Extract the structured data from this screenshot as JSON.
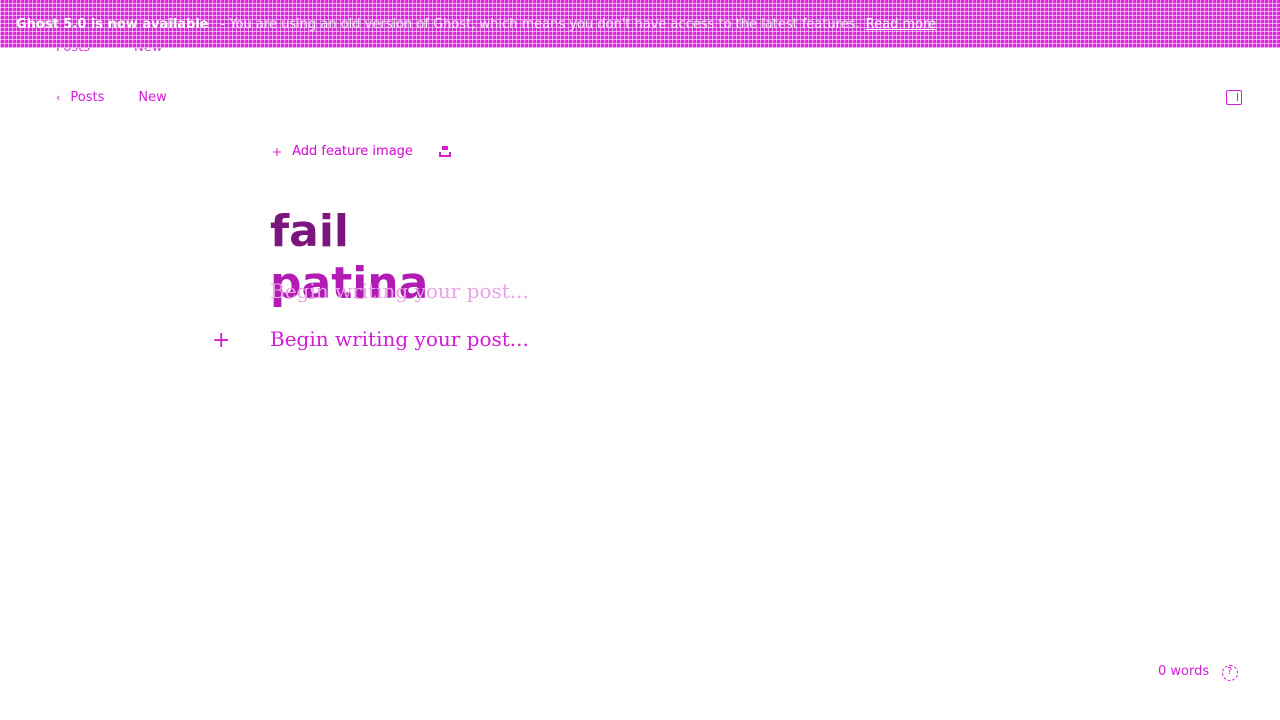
{
  "banner": {
    "strong": "Ghost 5.0 is now available",
    "message": "- You are using an old version of Ghost, which means you don't have access to the latest features.",
    "link": "Read more"
  },
  "nav": {
    "back_label": "Posts",
    "status_label": "New",
    "chevron_glyph": "‹"
  },
  "feature": {
    "plus_glyph": "+",
    "label": "Add feature image"
  },
  "title": {
    "line1": "fail",
    "line2": "patina"
  },
  "editor": {
    "plus_glyph": "+",
    "placeholder": "Begin writing your post..."
  },
  "footer": {
    "wordcount": "0 words"
  },
  "icons": {
    "layout": "sidebar-toggle-icon",
    "unsplash": "unsplash-icon",
    "help": "help-icon",
    "back": "chevron-left-icon"
  },
  "colors": {
    "accent": "#d41bd8",
    "banner": "#e024e4",
    "title": "#7a167c"
  }
}
